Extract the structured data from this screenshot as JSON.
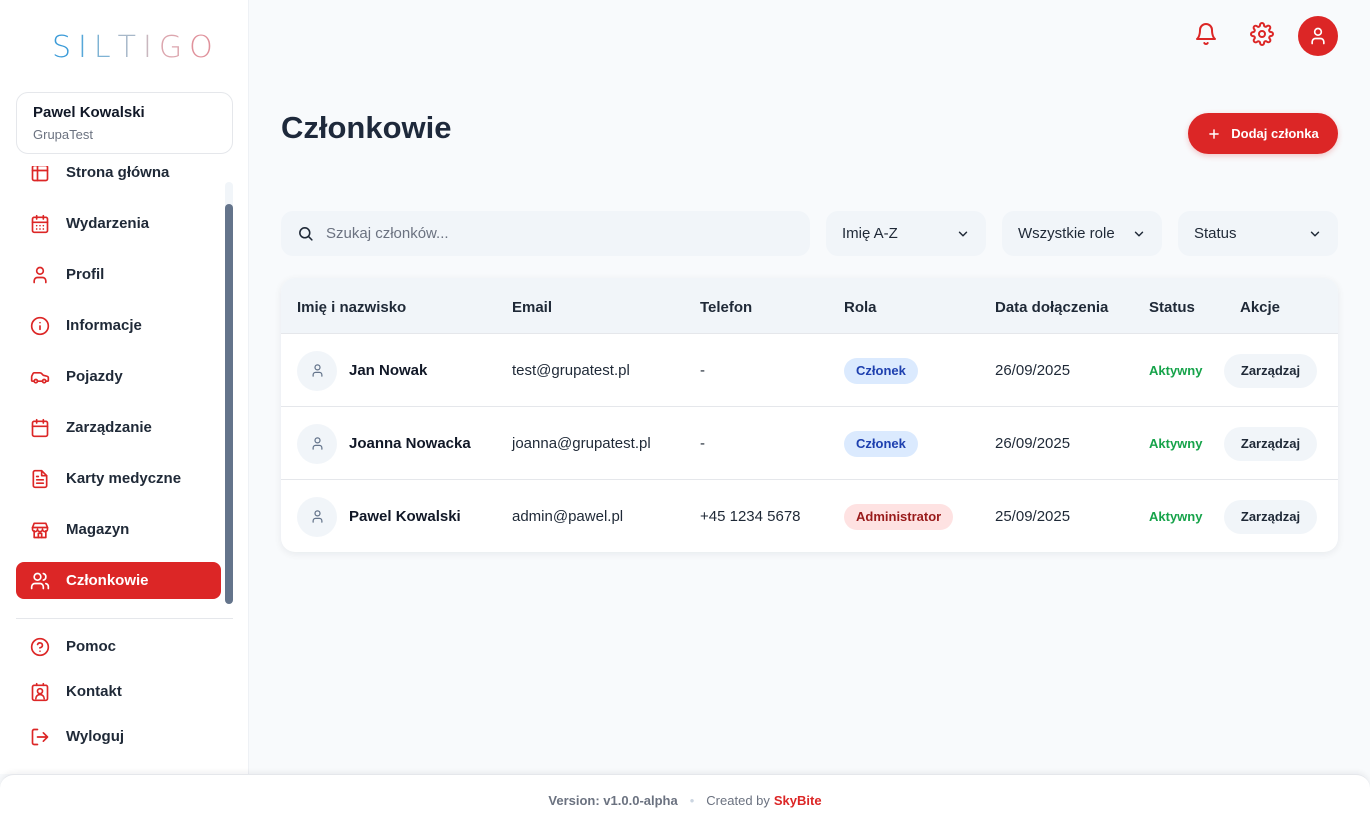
{
  "app": {
    "logo_letters": [
      "S",
      "I",
      "L",
      "T",
      "I",
      "G",
      "O"
    ],
    "logo_colors": [
      "#3b9bd8",
      "#56a7d9",
      "#7fb3d4",
      "#a7b8c9",
      "#c9b7bf",
      "#dca6ae",
      "#e0929c"
    ]
  },
  "user": {
    "name": "Pawel Kowalski",
    "group": "GrupaTest"
  },
  "nav": {
    "items": [
      {
        "label": "Strona główna",
        "icon": "grid-icon"
      },
      {
        "label": "Wydarzenia",
        "icon": "calendar-icon"
      },
      {
        "label": "Profil",
        "icon": "user-icon"
      },
      {
        "label": "Informacje",
        "icon": "info-icon"
      },
      {
        "label": "Pojazdy",
        "icon": "car-icon"
      },
      {
        "label": "Zarządzanie",
        "icon": "calendar-icon"
      },
      {
        "label": "Karty medyczne",
        "icon": "file-icon"
      },
      {
        "label": "Magazyn",
        "icon": "store-icon"
      },
      {
        "label": "Członkowie",
        "icon": "users-icon",
        "active": true
      }
    ],
    "bottom": [
      {
        "label": "Pomoc",
        "icon": "help-icon"
      },
      {
        "label": "Kontakt",
        "icon": "contact-icon"
      },
      {
        "label": "Wyloguj",
        "icon": "logout-icon"
      }
    ]
  },
  "page": {
    "title": "Członkowie",
    "add_button": "Dodaj członka"
  },
  "filters": {
    "search_placeholder": "Szukaj członków...",
    "sort": "Imię A-Z",
    "role": "Wszystkie role",
    "status": "Status"
  },
  "table": {
    "headers": [
      "Imię i nazwisko",
      "Email",
      "Telefon",
      "Rola",
      "Data dołączenia",
      "Status",
      "Akcje"
    ],
    "rows": [
      {
        "name": "Jan Nowak",
        "email": "test@grupatest.pl",
        "phone": "-",
        "role": "Członek",
        "role_type": "member",
        "joined": "26/09/2025",
        "status": "Aktywny",
        "action": "Zarządzaj"
      },
      {
        "name": "Joanna Nowacka",
        "email": "joanna@grupatest.pl",
        "phone": "-",
        "role": "Członek",
        "role_type": "member",
        "joined": "26/09/2025",
        "status": "Aktywny",
        "action": "Zarządzaj"
      },
      {
        "name": "Pawel Kowalski",
        "email": "admin@pawel.pl",
        "phone": "+45 1234 5678",
        "role": "Administrator",
        "role_type": "admin",
        "joined": "25/09/2025",
        "status": "Aktywny",
        "action": "Zarządzaj"
      }
    ]
  },
  "footer": {
    "version": "Version: v1.0.0-alpha",
    "dot": "•",
    "created_by": "Created by",
    "brand": "SkyBite"
  },
  "colors": {
    "accent": "#dc2626",
    "status_active": "#16a34a"
  }
}
